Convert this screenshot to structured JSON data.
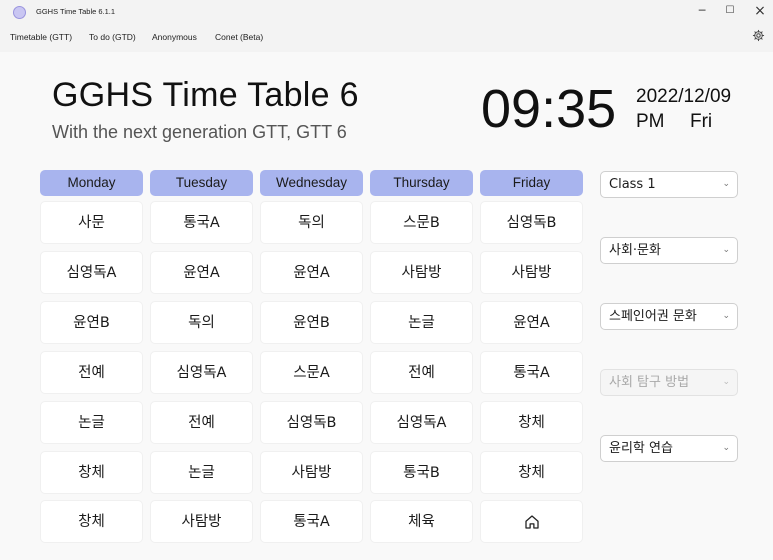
{
  "window": {
    "title": "GGHS Time Table 6.1.1",
    "controls": {
      "minimize": "─",
      "maximize": "☐",
      "close": "×"
    }
  },
  "menu": {
    "items": [
      "Timetable (GTT)",
      "To do (GTD)",
      "Anonymous",
      "Conet (Beta)"
    ],
    "settings_icon": "gear-icon"
  },
  "header": {
    "title": "GGHS Time Table 6",
    "subtitle": "With the next generation GTT, GTT 6"
  },
  "clock": {
    "time": "09:35",
    "date": "2022/12/09",
    "ampm": "PM",
    "weekday": "Fri"
  },
  "timetable": {
    "days": [
      "Monday",
      "Tuesday",
      "Wednesday",
      "Thursday",
      "Friday"
    ],
    "rows": [
      [
        "사문",
        "통국A",
        "독의",
        "스문B",
        "심영독B"
      ],
      [
        "심영독A",
        "윤연A",
        "윤연A",
        "사탐방",
        "사탐방"
      ],
      [
        "윤연B",
        "독의",
        "윤연B",
        "논글",
        "윤연A"
      ],
      [
        "전예",
        "심영독A",
        "스문A",
        "전예",
        "통국A"
      ],
      [
        "논글",
        "전예",
        "심영독B",
        "심영독A",
        "창체"
      ],
      [
        "창체",
        "논글",
        "사탐방",
        "통국B",
        "창체"
      ],
      [
        "창체",
        "사탐방",
        "통국A",
        "체육",
        ""
      ]
    ],
    "last_cell_icon": "home-icon",
    "header_color": "#a8b4ee"
  },
  "selectors": [
    {
      "value": "Class 1",
      "enabled": true
    },
    {
      "value": "사회·문화",
      "enabled": true
    },
    {
      "value": "스페인어권 문화",
      "enabled": true
    },
    {
      "value": "사회 탐구 방법",
      "enabled": false
    },
    {
      "value": "윤리학 연습",
      "enabled": true
    }
  ]
}
